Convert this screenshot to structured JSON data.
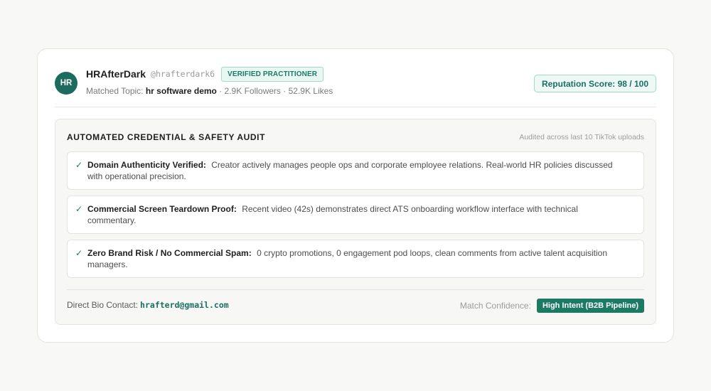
{
  "profile": {
    "avatar_initials": "HR",
    "display_name": "HRAfterDark",
    "handle": "@hrafterdark6",
    "verified_label": "VERIFIED PRACTITIONER",
    "topic_label": "Matched Topic:",
    "topic": "hr software demo",
    "followers": "· 2.9K Followers",
    "likes": "· 52.9K Likes",
    "reputation_score": "Reputation Score: 98 / 100"
  },
  "audit": {
    "title": "AUTOMATED CREDENTIAL & SAFETY AUDIT",
    "note": "Audited across last 10 TikTok uploads",
    "items": [
      {
        "label": "Domain Authenticity Verified:",
        "text": "Creator actively manages people ops and corporate employee relations. Real-world HR policies discussed with operational precision."
      },
      {
        "label": "Commercial Screen Teardown Proof:",
        "text": "Recent video (42s) demonstrates direct ATS onboarding workflow interface with technical commentary."
      },
      {
        "label": "Zero Brand Risk / No Commercial Spam:",
        "text": "0 crypto promotions, 0 engagement pod loops, clean comments from active talent acquisition managers."
      }
    ],
    "check_glyph": "✓",
    "contact_label": "Direct Bio Contact:",
    "contact_email": "hrafterd@gmail.com",
    "confidence_label": "Match Confidence:",
    "confidence_value": "High Intent (B2B Pipeline)"
  },
  "colors": {
    "accent": "#1b7a62",
    "avatar": "#1c6b5e",
    "badge_border": "#9edcc8"
  }
}
